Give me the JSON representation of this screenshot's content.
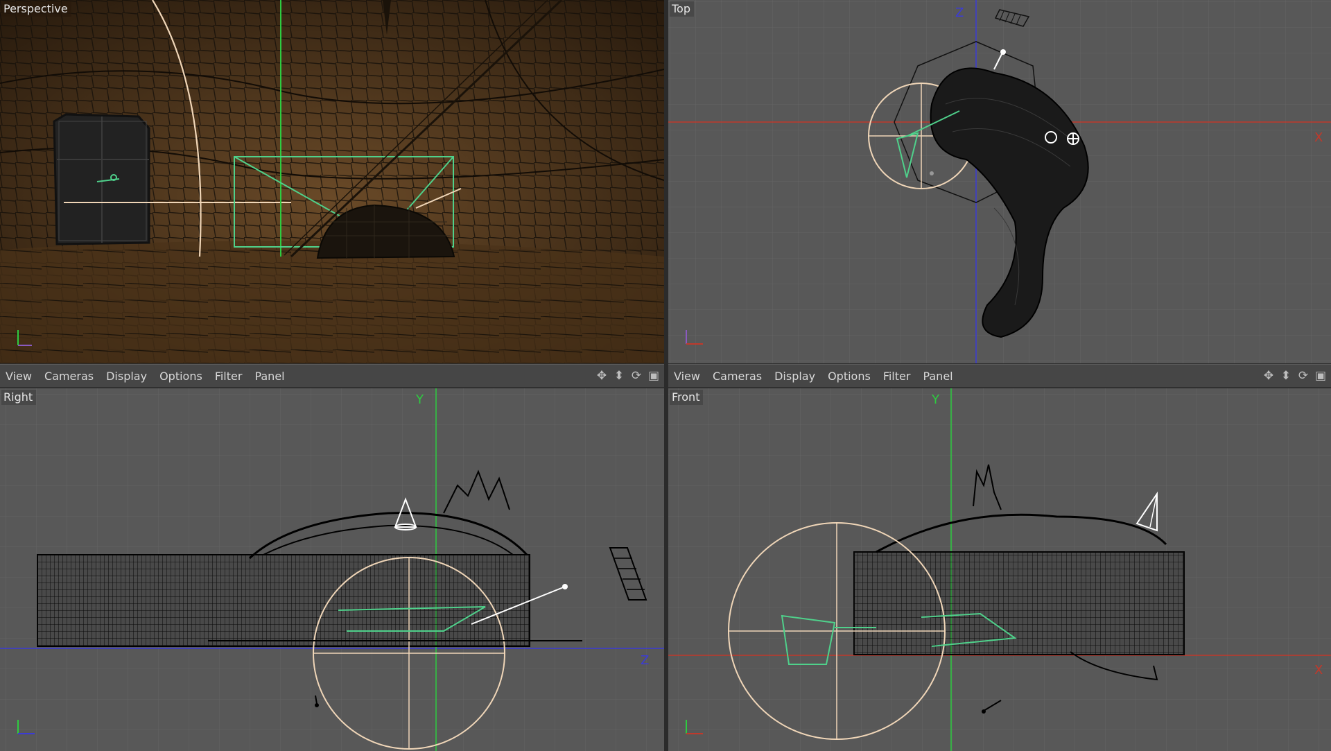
{
  "viewports": {
    "perspective": {
      "label": "Perspective"
    },
    "top": {
      "label": "Top",
      "axis_z": "Z",
      "axis_x": "X"
    },
    "right": {
      "label": "Right",
      "axis_y": "Y",
      "axis_z": "Z"
    },
    "front": {
      "label": "Front",
      "axis_y": "Y",
      "axis_x": "X"
    }
  },
  "menubar_left": {
    "items": [
      "View",
      "Cameras",
      "Display",
      "Options",
      "Filter",
      "Panel"
    ],
    "icons": [
      "move-view-icon",
      "dolly-view-icon",
      "rotate-view-icon",
      "maximize-view-icon"
    ]
  },
  "menubar_right": {
    "items": [
      "View",
      "Cameras",
      "Display",
      "Options",
      "Filter",
      "Panel"
    ],
    "icons": [
      "move-view-icon",
      "dolly-view-icon",
      "rotate-view-icon",
      "maximize-view-icon"
    ]
  },
  "colors": {
    "grid_bg": "#585858",
    "grid_line": "#666666",
    "axis_x": "#c0392b",
    "axis_y": "#2ecc40",
    "axis_z": "#3b3bd6",
    "wire": "#111111",
    "selected": "#4fd18b",
    "light": "#f0d6b8",
    "cave": "#3d2a17"
  }
}
